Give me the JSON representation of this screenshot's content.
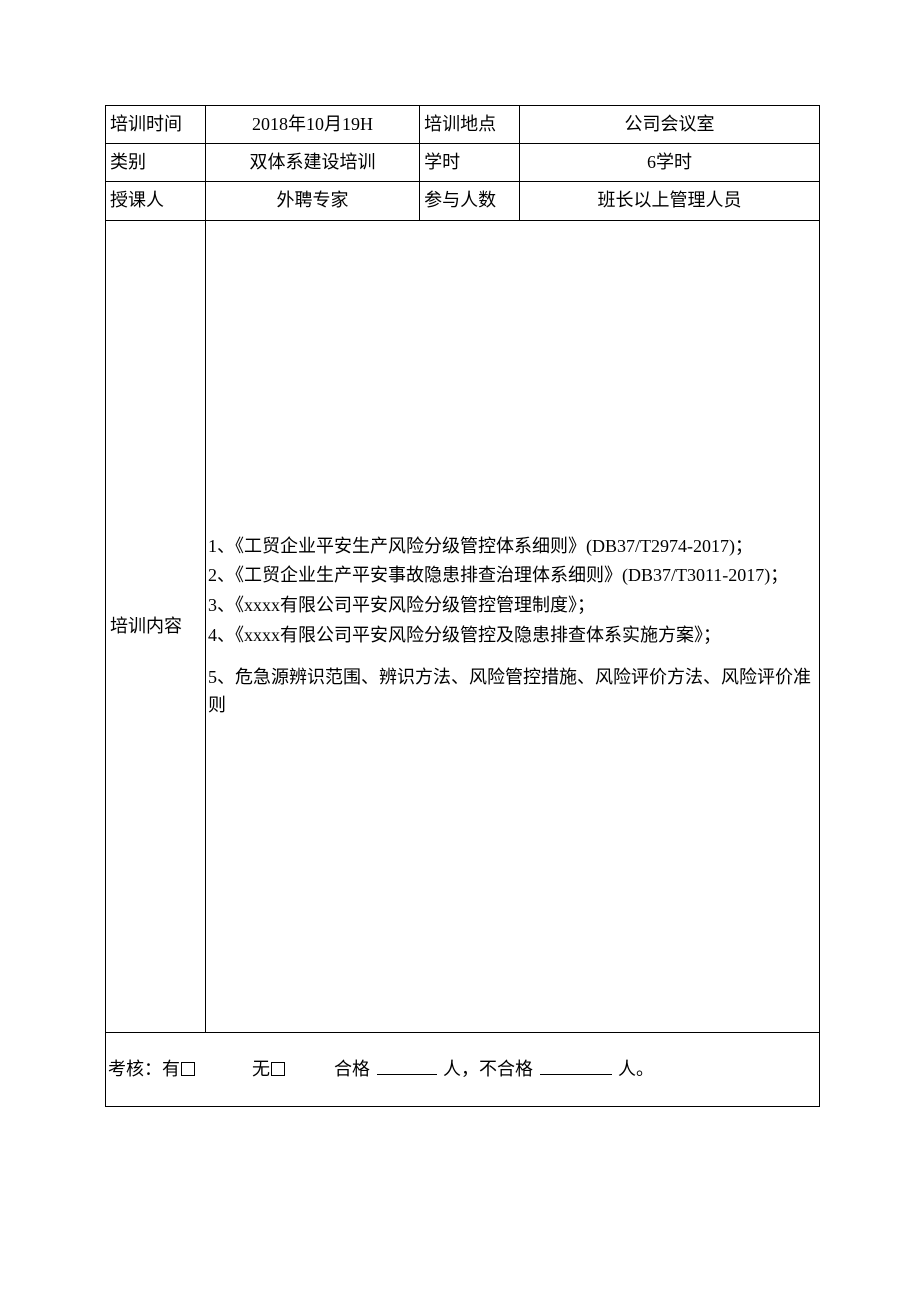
{
  "row1": {
    "label1": "培训时间",
    "value1": "2018年10月19H",
    "label2": "培训地点",
    "value2": "公司会议室"
  },
  "row2": {
    "label1": "类别",
    "value1": "双体系建设培训",
    "label2": "学时",
    "value2": "6学时"
  },
  "row3": {
    "label1": "授课人",
    "value1": "外聘专家",
    "label2": "参与人数",
    "value2": "班长以上管理人员"
  },
  "content": {
    "label": "培训内容",
    "items": [
      "1、《工贸企业平安生产风险分级管控体系细则》(DB37/T2974-2017)；",
      "2、《工贸企业生产平安事故隐患排查治理体系细则》(DB37/T3011-2017)；",
      "3、《xxxx有限公司平安风险分级管控管理制度》；",
      "4、《xxxx有限公司平安风险分级管控及隐患排查体系实施方案》；",
      "5、危急源辨识范围、辨识方法、风险管控措施、风险评价方法、风险评价准则"
    ]
  },
  "assessment": {
    "prefix": "考核：有",
    "none": "无",
    "pass": "合格",
    "people1": "人，不合格",
    "people2": "人。"
  }
}
